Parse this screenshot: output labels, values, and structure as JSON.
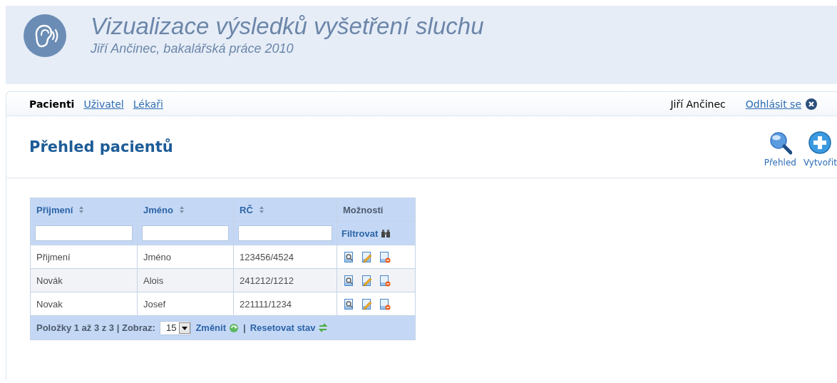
{
  "header": {
    "title": "Vizualizace výsledků vyšetření sluchu",
    "subtitle": "Jiří Ančinec, bakalářská práce 2010"
  },
  "nav": {
    "items": [
      {
        "label": "Pacienti",
        "selected": true
      },
      {
        "label": "Uživatel",
        "selected": false
      },
      {
        "label": "Lékaři",
        "selected": false
      }
    ],
    "user": "Jiří Ančinec",
    "logout": "Odhlásit se"
  },
  "page": {
    "title": "Přehled pacientů",
    "actions": [
      {
        "label": "Přehled",
        "kind": "search"
      },
      {
        "label": "Vytvořit",
        "kind": "create"
      }
    ]
  },
  "table": {
    "columns": [
      {
        "label": "Přijmení",
        "sortable": true
      },
      {
        "label": "Jméno",
        "sortable": true
      },
      {
        "label": "RČ",
        "sortable": true
      },
      {
        "label": "Možnosti",
        "sortable": false
      }
    ],
    "filter_button": "Filtrovat",
    "rows": [
      [
        "Přijmení",
        "Jméno",
        "123456/4524"
      ],
      [
        "Novák",
        "Alois",
        "241212/1212"
      ],
      [
        "Novak",
        "Josef",
        "221111/1234"
      ]
    ],
    "footer": {
      "summary": "Položky 1 až 3 z 3 | Zobraz:",
      "page_size": "15",
      "change": "Změnit",
      "separator": "|",
      "reset": "Resetovat stav"
    }
  }
}
